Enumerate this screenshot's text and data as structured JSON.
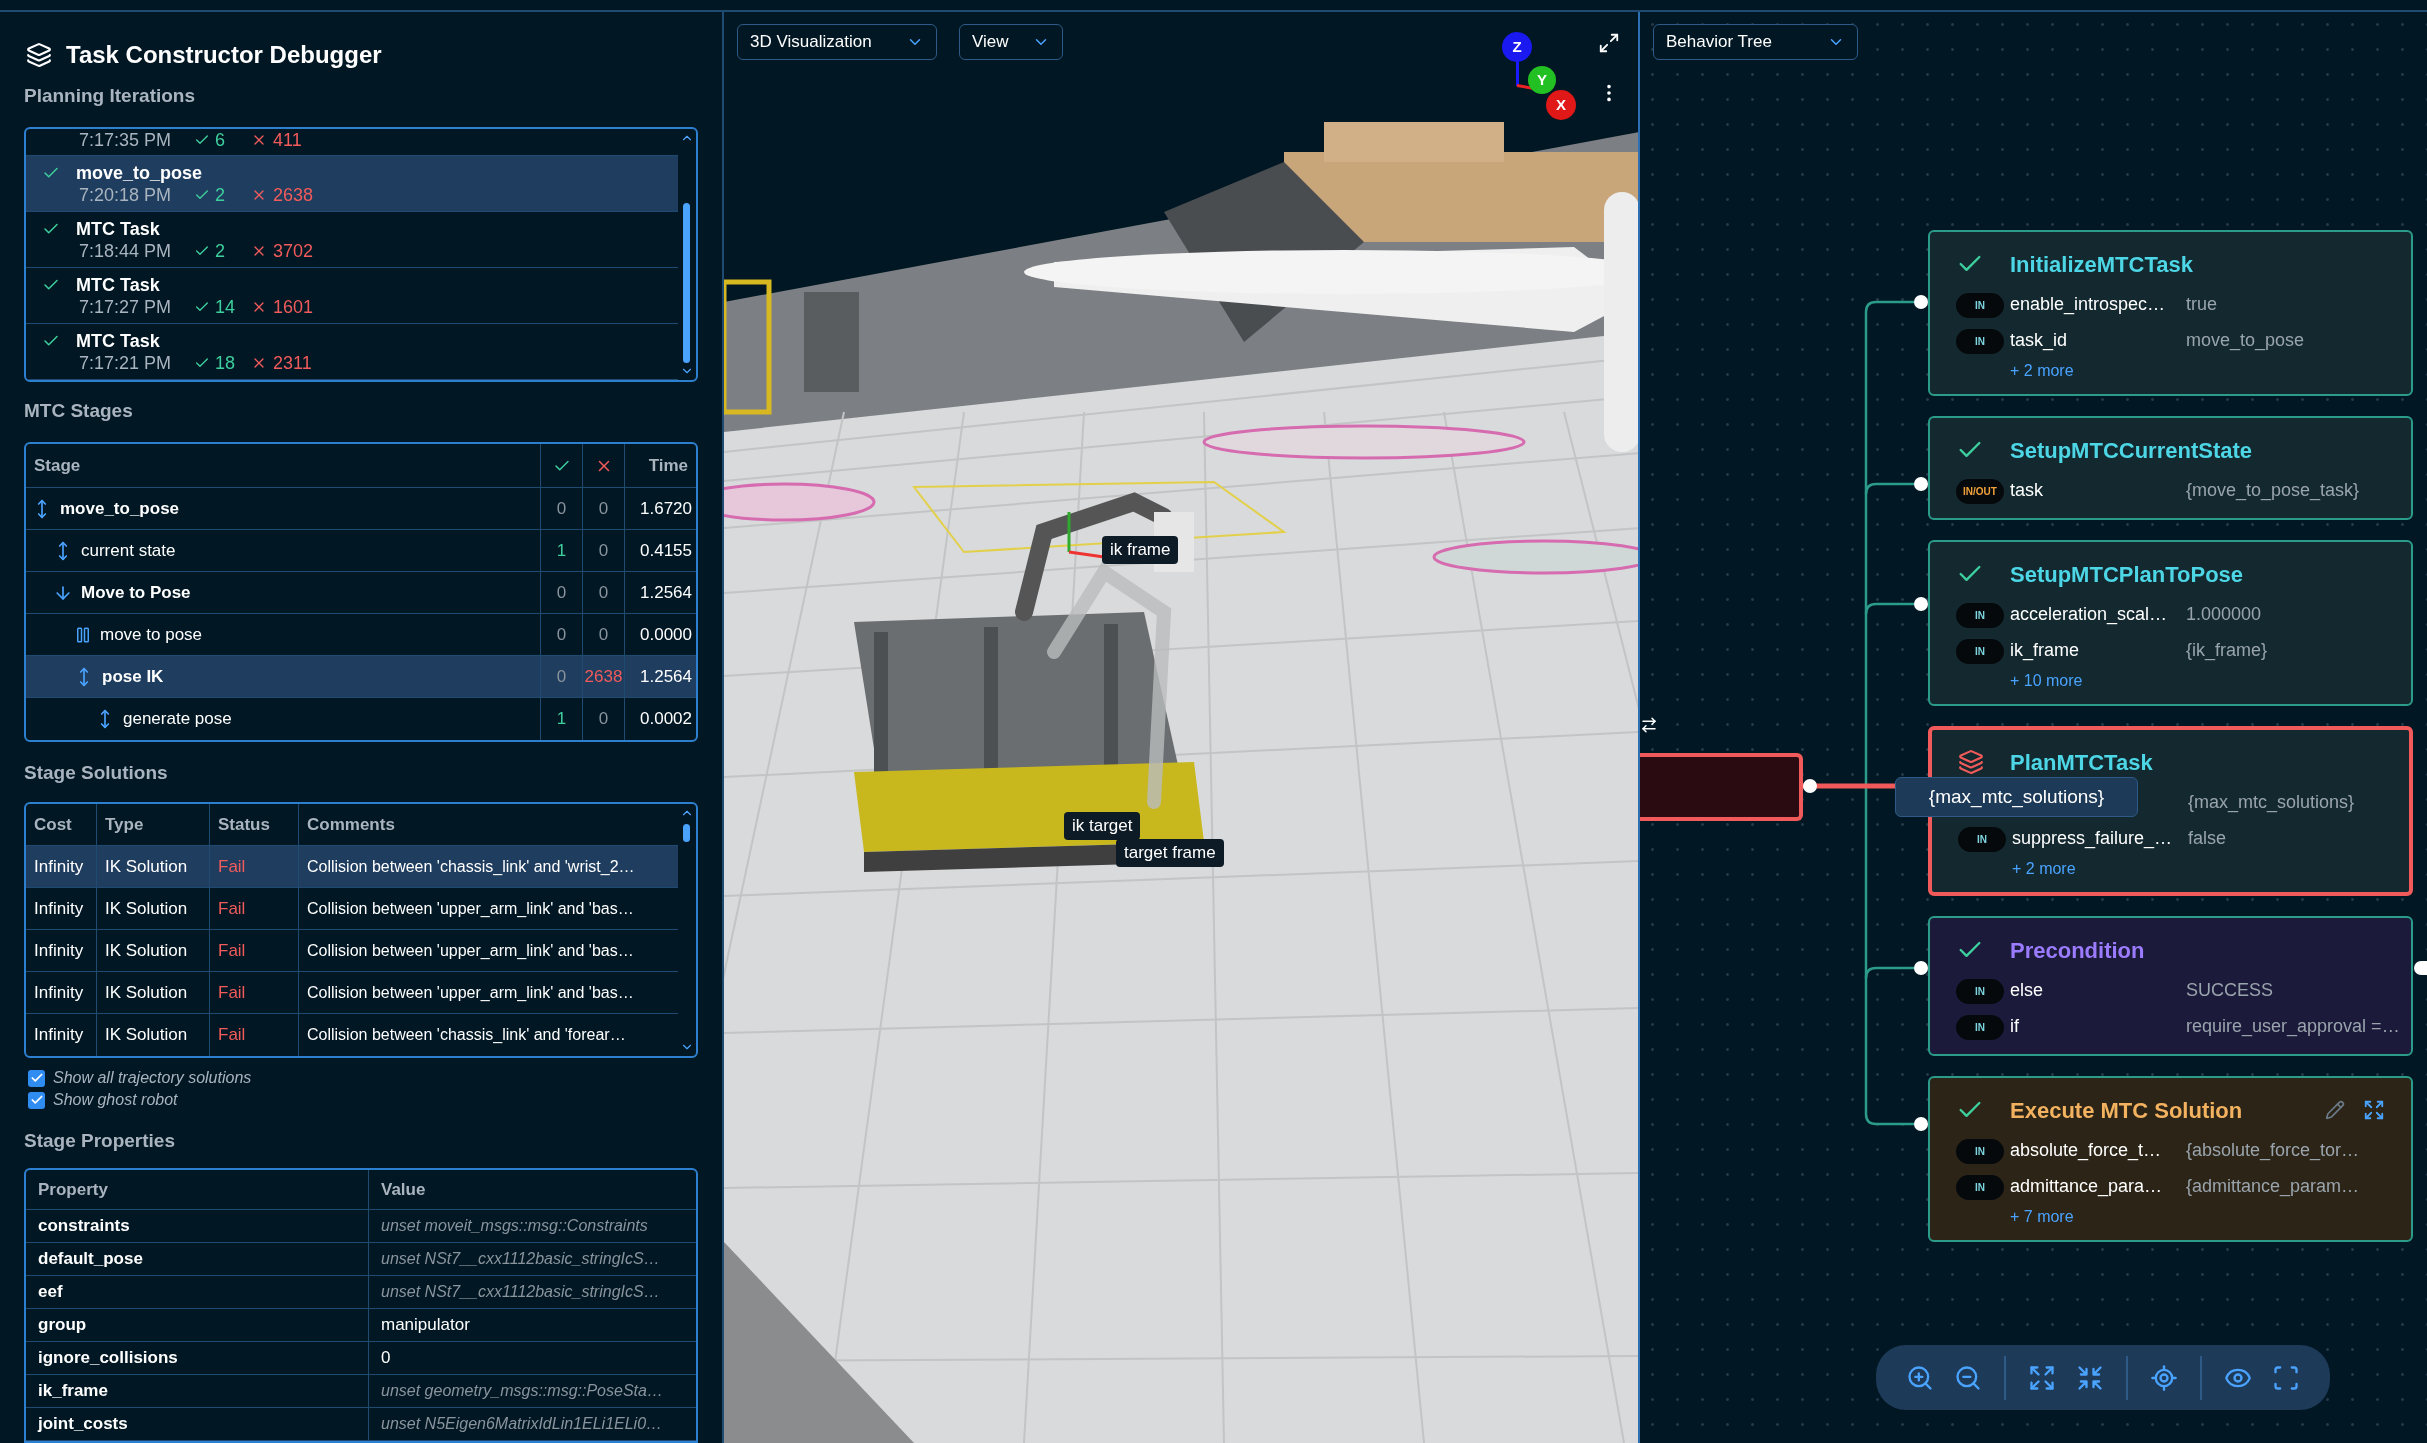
{
  "app": {
    "title": "Task Constructor Debugger"
  },
  "planning_iterations": {
    "heading": "Planning Iterations",
    "items": [
      {
        "time": "7:17:35 PM",
        "ok": "6",
        "fail": "411",
        "selected": false
      },
      {
        "name": "move_to_pose",
        "time": "7:20:18 PM",
        "ok": "2",
        "fail": "2638",
        "selected": true
      },
      {
        "name": "MTC Task",
        "time": "7:18:44 PM",
        "ok": "2",
        "fail": "3702",
        "selected": false
      },
      {
        "name": "MTC Task",
        "time": "7:17:27 PM",
        "ok": "14",
        "fail": "1601",
        "selected": false
      },
      {
        "name": "MTC Task",
        "time": "7:17:21 PM",
        "ok": "18",
        "fail": "2311",
        "selected": false
      }
    ]
  },
  "mtc_stages": {
    "heading": "MTC Stages",
    "columns": [
      {
        "kind": "text",
        "label": "Stage"
      },
      {
        "kind": "ok"
      },
      {
        "kind": "fail"
      },
      {
        "kind": "text",
        "label": "Time"
      }
    ],
    "rows": [
      {
        "name": "move_to_pose",
        "kind": "updown",
        "ok": "0",
        "fail": "0",
        "time": "1.6720",
        "selected": false,
        "children": [
          {
            "name": "current state",
            "kind": "updown",
            "ok": "1",
            "fail": "0",
            "time": "0.4155",
            "selected": false
          },
          {
            "name": "Move to Pose",
            "kind": "down",
            "ok": "0",
            "fail": "0",
            "time": "1.2564",
            "selected": false,
            "children": [
              {
                "name": "move to pose",
                "kind": "pause",
                "ok": "0",
                "fail": "0",
                "time": "0.0000",
                "selected": false
              },
              {
                "name": "pose IK",
                "kind": "updown",
                "ok": "0",
                "fail": "2638",
                "time": "1.2564",
                "selected": true,
                "children": [
                  {
                    "name": "generate pose",
                    "kind": "updown",
                    "ok": "1",
                    "fail": "0",
                    "time": "0.0002",
                    "selected": false
                  }
                ]
              }
            ]
          }
        ]
      }
    ]
  },
  "stage_solutions": {
    "heading": "Stage Solutions",
    "columns": [
      "Cost",
      "Type",
      "Status",
      "Comments"
    ],
    "rows": [
      {
        "cost": "Infinity",
        "type": "IK Solution",
        "status": "Fail",
        "failed": true,
        "comment": "Collision between 'chassis_link' and 'wrist_2…",
        "selected": true
      },
      {
        "cost": "Infinity",
        "type": "IK Solution",
        "status": "Fail",
        "failed": true,
        "comment": "Collision between 'upper_arm_link' and 'bas…",
        "selected": false
      },
      {
        "cost": "Infinity",
        "type": "IK Solution",
        "status": "Fail",
        "failed": true,
        "comment": "Collision between 'upper_arm_link' and 'bas…",
        "selected": false
      },
      {
        "cost": "Infinity",
        "type": "IK Solution",
        "status": "Fail",
        "failed": true,
        "comment": "Collision between 'upper_arm_link' and 'bas…",
        "selected": false
      },
      {
        "cost": "Infinity",
        "type": "IK Solution",
        "status": "Fail",
        "failed": true,
        "comment": "Collision between 'chassis_link' and 'forear…",
        "selected": false
      }
    ]
  },
  "options": [
    {
      "label": "Show all trajectory solutions",
      "checked": true
    },
    {
      "label": "Show ghost robot",
      "checked": true
    }
  ],
  "stage_properties": {
    "heading": "Stage Properties",
    "columns": [
      "Property",
      "Value"
    ],
    "rows": [
      {
        "name": "constraints",
        "value": "unset moveit_msgs::msg::Constraints",
        "unset": true
      },
      {
        "name": "default_pose",
        "value": "unset NSt7__cxx1112basic_stringIcS…",
        "unset": true
      },
      {
        "name": "eef",
        "value": "unset NSt7__cxx1112basic_stringIcS…",
        "unset": true
      },
      {
        "name": "group",
        "value": "manipulator",
        "unset": false
      },
      {
        "name": "ignore_collisions",
        "value": "0",
        "unset": false
      },
      {
        "name": "ik_frame",
        "value": "unset geometry_msgs::msg::PoseSta…",
        "unset": true
      },
      {
        "name": "joint_costs",
        "value": "unset N5Eigen6MatrixIdLin1ELi1ELi0…",
        "unset": true
      }
    ]
  },
  "viewport": {
    "dropdowns": [
      "3D Visualization",
      "View"
    ],
    "axes": {
      "z": "Z",
      "y": "Y",
      "x": "X"
    },
    "labels": [
      "ik frame",
      "ik target",
      "target frame"
    ]
  },
  "behavior_tree": {
    "dropdown": "Behavior Tree",
    "nodes": [
      {
        "kind": "action",
        "failed": false,
        "title": "InitializeMTCTask",
        "ports": [
          {
            "kind": "in",
            "badge": "IN",
            "name": "enable_introspec…",
            "value": "true"
          },
          {
            "kind": "in",
            "badge": "IN",
            "name": "task_id",
            "value": "move_to_pose"
          }
        ],
        "more": "+ 2 more"
      },
      {
        "kind": "action",
        "failed": false,
        "title": "SetupMTCCurrentState",
        "ports": [
          {
            "kind": "inout",
            "badge": "IN/OUT",
            "name": "task",
            "value": "{move_to_pose_task}"
          }
        ]
      },
      {
        "kind": "action",
        "failed": false,
        "title": "SetupMTCPlanToPose",
        "ports": [
          {
            "kind": "in",
            "badge": "IN",
            "name": "acceleration_scal…",
            "value": "1.000000"
          },
          {
            "kind": "in",
            "badge": "IN",
            "name": "ik_frame",
            "value": "{ik_frame}"
          }
        ],
        "more": "+ 10 more"
      },
      {
        "kind": "action",
        "failed": true,
        "title": "PlanMTCTask",
        "tooltip": "{max_mtc_solutions}",
        "ports": [
          {
            "value": "{max_mtc_solutions}"
          },
          {
            "kind": "in",
            "badge": "IN",
            "name": "suppress_failure_…",
            "value": "false"
          }
        ],
        "more": "+ 2 more"
      },
      {
        "kind": "condition",
        "failed": false,
        "title": "Precondition",
        "ports": [
          {
            "kind": "in",
            "badge": "IN",
            "name": "else",
            "value": "SUCCESS"
          },
          {
            "kind": "in",
            "badge": "IN",
            "name": "if",
            "value": "require_user_approval =…"
          }
        ]
      },
      {
        "kind": "subtree",
        "failed": false,
        "title": "Execute MTC Solution",
        "ports": [
          {
            "kind": "in",
            "badge": "IN",
            "name": "absolute_force_t…",
            "value": "{absolute_force_tor…"
          },
          {
            "kind": "in",
            "badge": "IN",
            "name": "admittance_para…",
            "value": "{admittance_param…"
          }
        ],
        "more": "+ 7 more"
      }
    ]
  }
}
